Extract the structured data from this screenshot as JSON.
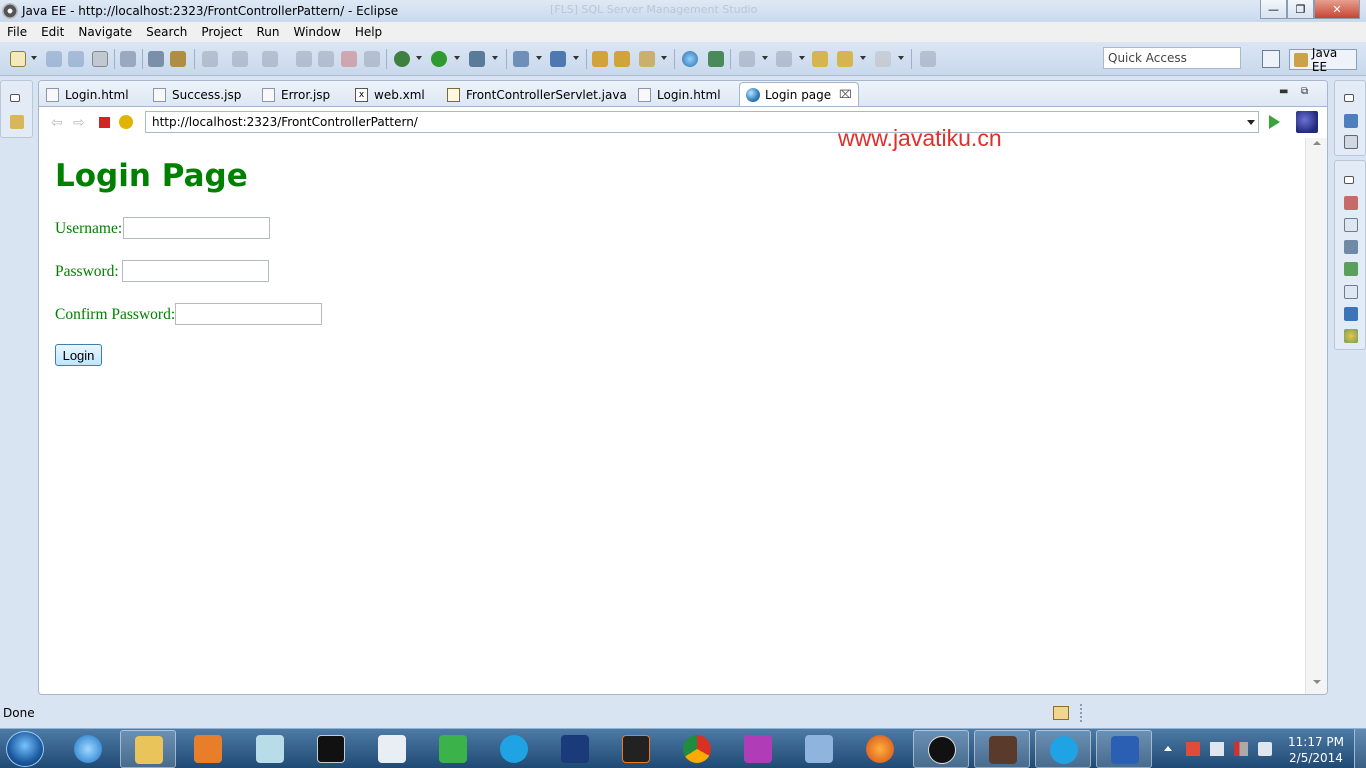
{
  "window": {
    "title": "Java EE - http://localhost:2323/FrontControllerPattern/ - Eclipse",
    "ghost_text": "[FLS] SQL Server Management Studio"
  },
  "menu": [
    "File",
    "Edit",
    "Navigate",
    "Search",
    "Project",
    "Run",
    "Window",
    "Help"
  ],
  "toolbar": {
    "quick_access": "Quick Access",
    "perspective": "Java EE"
  },
  "editor_tabs": [
    {
      "label": "Login.html",
      "icon": "html-file-icon"
    },
    {
      "label": "Success.jsp",
      "icon": "jsp-file-icon"
    },
    {
      "label": "Error.jsp",
      "icon": "jsp-file-icon"
    },
    {
      "label": "web.xml",
      "icon": "xml-file-icon"
    },
    {
      "label": "FrontControllerServlet.java",
      "icon": "java-file-icon"
    },
    {
      "label": "Login.html",
      "icon": "html-file-icon"
    },
    {
      "label": "Login page",
      "icon": "globe-icon",
      "active": true
    }
  ],
  "browser": {
    "url": "http://localhost:2323/FrontControllerPattern/"
  },
  "page": {
    "heading": "Login Page",
    "username_label": "Username:",
    "password_label": "Password:",
    "confirm_label": "Confirm Password:",
    "username_value": "",
    "password_value": "",
    "confirm_value": "",
    "login_button": "Login",
    "heading_color": "#008000"
  },
  "watermark": "www.javatiku.cn",
  "status": {
    "text": "Done"
  },
  "taskbar": {
    "time": "11:17 PM",
    "date": "2/5/2014",
    "apps": [
      "internet-explorer-icon",
      "file-explorer-icon",
      "media-player-icon",
      "notes-icon",
      "cmd-icon",
      "wordpad-icon",
      "app-green-icon",
      "skype-icon",
      "cald3-icon",
      "ms-tc-icon",
      "chrome-icon",
      "feather-icon",
      "virtualbox-icon",
      "firefox-icon",
      "p-app-icon",
      "eclipse-java-ee-icon",
      "skype-icon",
      "word-icon"
    ]
  }
}
